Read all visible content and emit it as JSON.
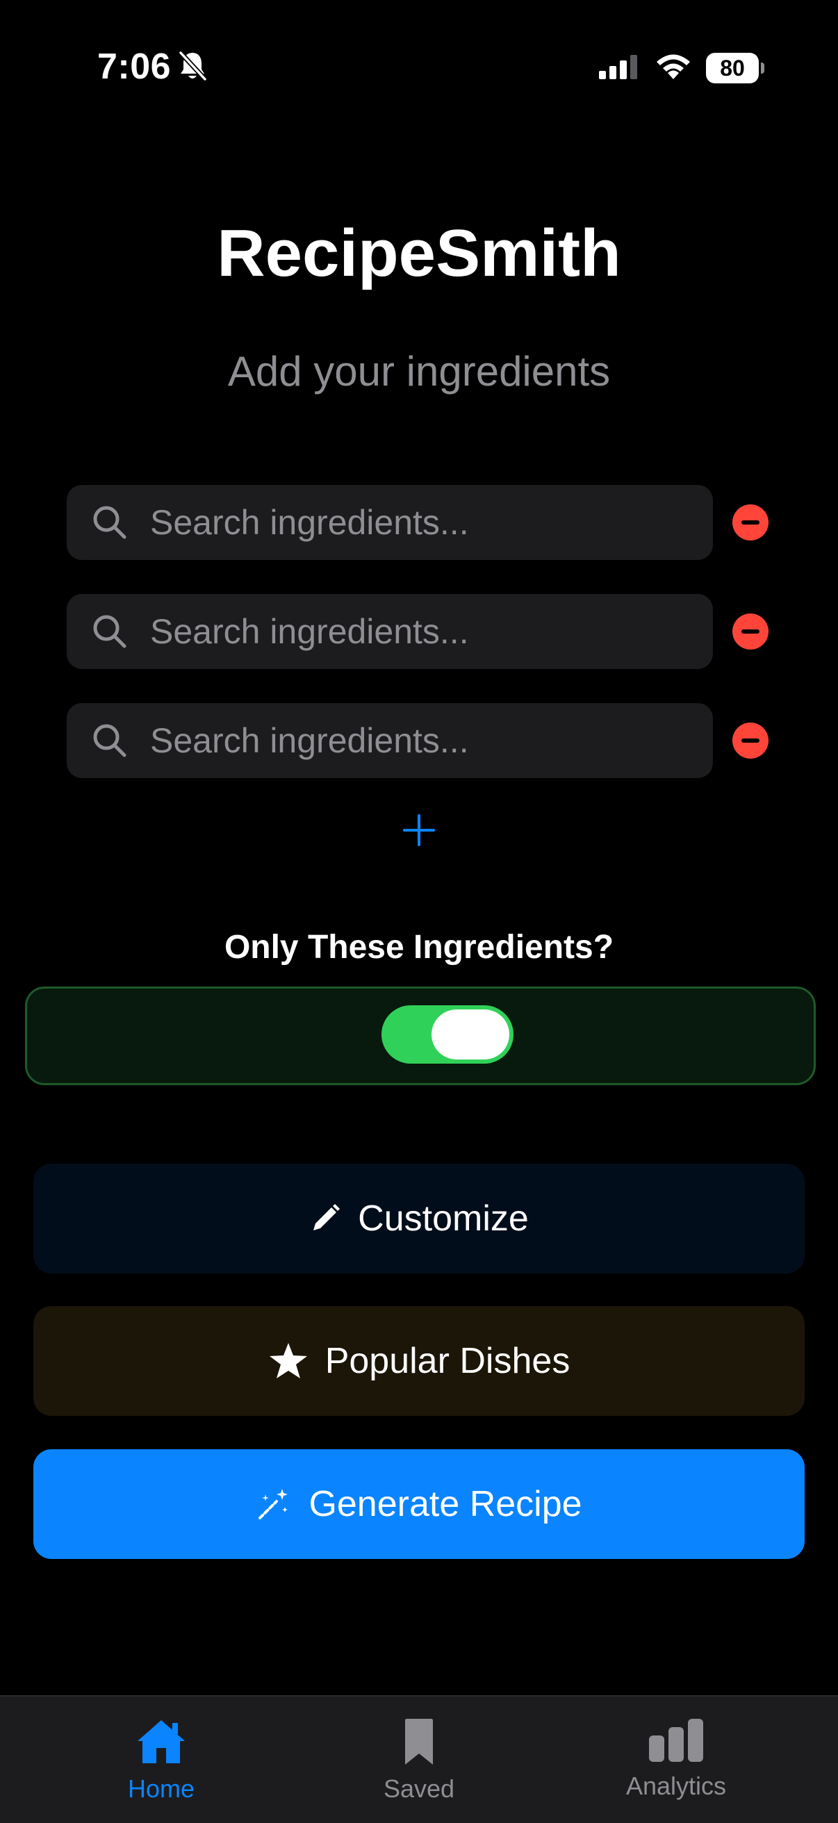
{
  "status_bar": {
    "time": "7:06",
    "battery": "80",
    "icons": [
      "bell-slash-icon",
      "signal-icon",
      "wifi-icon",
      "battery-icon"
    ]
  },
  "app": {
    "title": "RecipeSmith",
    "subtitle": "Add your ingredients"
  },
  "ingredients": {
    "rows": [
      {
        "placeholder": "Search ingredients...",
        "value": ""
      },
      {
        "placeholder": "Search ingredients...",
        "value": ""
      },
      {
        "placeholder": "Search ingredients...",
        "value": ""
      }
    ],
    "add_icon": "plus-icon",
    "remove_icon": "minus-circle-icon"
  },
  "only_these": {
    "label": "Only These Ingredients?",
    "enabled": true
  },
  "buttons": {
    "customize": {
      "label": "Customize",
      "icon": "pencil-icon"
    },
    "popular": {
      "label": "Popular Dishes",
      "icon": "star-icon"
    },
    "generate": {
      "label": "Generate Recipe",
      "icon": "magic-wand-icon"
    }
  },
  "tabs": [
    {
      "label": "Home",
      "icon": "house-icon",
      "active": true
    },
    {
      "label": "Saved",
      "icon": "bookmark-icon",
      "active": false
    },
    {
      "label": "Analytics",
      "icon": "bar-chart-icon",
      "active": false
    }
  ],
  "colors": {
    "accent": "#0a84ff",
    "destructive": "#ff453a",
    "toggle_on": "#30d158",
    "tab_inactive": "#8e8e93",
    "background": "#000000"
  }
}
